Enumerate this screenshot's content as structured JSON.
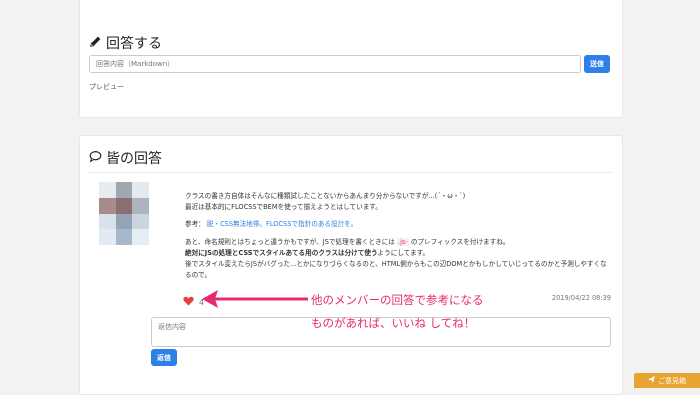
{
  "answer_form": {
    "heading": "回答する",
    "input_placeholder": "回答内容（Markdown）",
    "submit_label": "送信",
    "preview_label": "プレビュー"
  },
  "answers": {
    "heading": "皆の回答",
    "comment": {
      "line1": "クラスの書き方自体はそんなに種類試したことないからあんまり分からないですが...(´・ω・`)",
      "line2": "最近は基本的にFLOCSSでBEMを使って揃えようとはしています。",
      "ref_prefix": "参考：",
      "ref_link": "脱・CSS無法地帯。FLOCSSで指針のある設計を。",
      "line4_a": "あと、命名規則とはちょっと違うかもですが、JSで処理を書くときには",
      "line4_code": ".js-",
      "line4_b": "のプレフィックスを付けますね。",
      "line5_bold": "絶対にJSの処理とCSSでスタイルあてる用のクラスは分けて使う",
      "line5_rest": "ようにしてます。",
      "line6": "後でスタイル変えたらJSがバグった...とかになりづらくなるのと、HTML側からもこの辺DOMとかもしかしていじってるのかと予測しやすくなるので。"
    },
    "like_count": "4",
    "timestamp": "2019/04/22 08:39",
    "reply_placeholder": "返信内容",
    "reply_submit_label": "返信"
  },
  "annotation": {
    "line1": "他のメンバーの回答で参考になる",
    "line2": "ものがあれば、いいね してね！"
  },
  "feedback_label": "ご意見箱",
  "colors": {
    "accent": "#2f7fe8",
    "annotation": "#e8296f",
    "heart": "#e8413b",
    "feedback": "#e8a431"
  }
}
